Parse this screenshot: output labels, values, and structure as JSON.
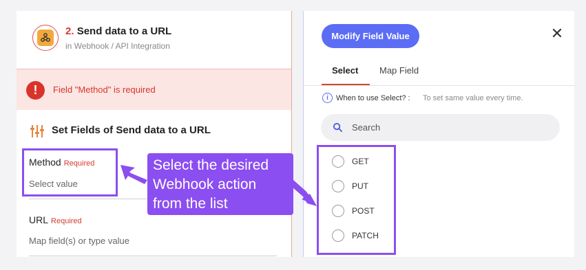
{
  "header": {
    "step_number": "2.",
    "step_title": "Send data to a URL",
    "step_subtitle": "in Webhook / API Integration"
  },
  "error": {
    "icon_glyph": "!",
    "message": "Field \"Method\" is required"
  },
  "section": {
    "title": "Set Fields of Send data to a URL"
  },
  "fields": {
    "method": {
      "label": "Method",
      "required": "Required",
      "value": "Select value"
    },
    "url": {
      "label": "URL",
      "required": "Required",
      "value": "Map field(s) or type value"
    }
  },
  "right_panel": {
    "modify_button": "Modify Field Value",
    "close_glyph": "✕",
    "tabs": [
      {
        "label": "Select",
        "active": true
      },
      {
        "label": "Map Field",
        "active": false
      }
    ],
    "info_question": "When to use Select? :",
    "info_answer": "To set same value every time.",
    "search_placeholder": "Search",
    "options": [
      "GET",
      "PUT",
      "POST",
      "PATCH"
    ]
  },
  "annotation": {
    "callout_line1": "Select the desired",
    "callout_line2": "Webhook action",
    "callout_line3": "from the list"
  },
  "colors": {
    "accent": "#5b6cf5",
    "error": "#d9342b",
    "annotation": "#8b4ef0"
  },
  "icons": {
    "app_logo": "webhook-icon",
    "error": "alert-circle-icon",
    "section": "sliders-icon",
    "info": "info-icon",
    "search": "search-icon",
    "close": "close-icon"
  }
}
